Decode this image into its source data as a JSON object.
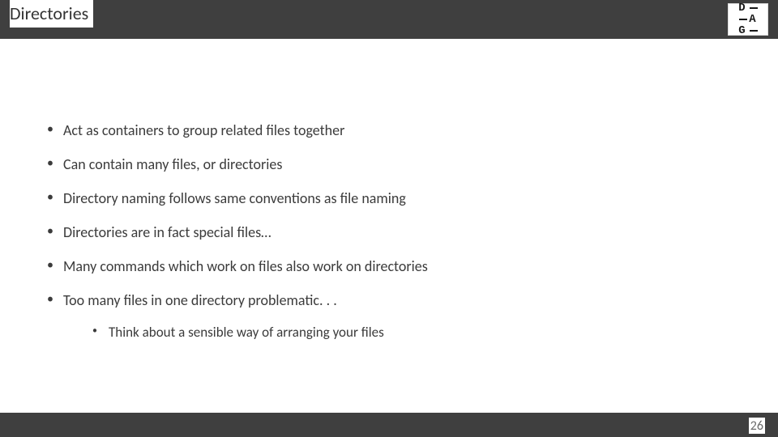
{
  "slide": {
    "title": "Directories",
    "logo_rows": [
      "D –",
      "A",
      "G –"
    ],
    "bullets": [
      "Act as containers to group related files together",
      "Can contain many files, or directories",
      "Directory naming follows same conventions as file naming",
      "Directories are in fact special files…",
      "Many commands which work on files also work on directories",
      "Too many files in one directory problematic. . ."
    ],
    "sub_bullet": "Think about a sensible way of arranging your files",
    "page_number": "26"
  }
}
